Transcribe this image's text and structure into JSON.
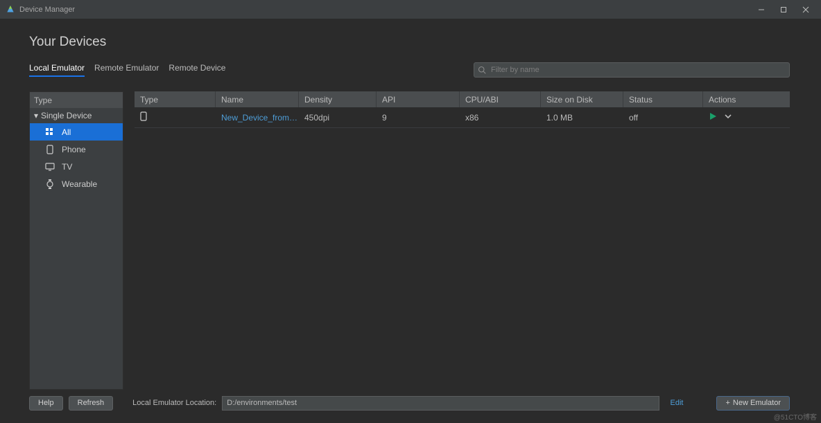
{
  "window": {
    "title": "Device Manager"
  },
  "page": {
    "heading": "Your Devices"
  },
  "tabs": {
    "local": "Local Emulator",
    "remote": "Remote Emulator",
    "device": "Remote Device",
    "active_index": 0
  },
  "search": {
    "placeholder": "Filter by name",
    "value": ""
  },
  "sidebar": {
    "header": "Type",
    "group": "Single Device",
    "items": [
      {
        "label": "All",
        "icon": "grid-icon",
        "selected": true
      },
      {
        "label": "Phone",
        "icon": "phone-icon",
        "selected": false
      },
      {
        "label": "TV",
        "icon": "tv-icon",
        "selected": false
      },
      {
        "label": "Wearable",
        "icon": "watch-icon",
        "selected": false
      }
    ]
  },
  "table": {
    "columns": {
      "type": "Type",
      "name": "Name",
      "density": "Density",
      "api": "API",
      "cpu": "CPU/ABI",
      "size": "Size on Disk",
      "status": "Status",
      "actions": "Actions"
    },
    "rows": [
      {
        "type_icon": "phone-icon",
        "name": "New_Device_from_...",
        "density": "450dpi",
        "api": "9",
        "cpu": "x86",
        "size": "1.0 MB",
        "status": "off"
      }
    ]
  },
  "footer": {
    "help_label": "Help",
    "refresh_label": "Refresh",
    "location_label": "Local Emulator Location:",
    "location_value": "D:/environments/test",
    "edit_label": "Edit",
    "new_emulator_label": "New Emulator"
  },
  "watermark": "@51CTO博客"
}
